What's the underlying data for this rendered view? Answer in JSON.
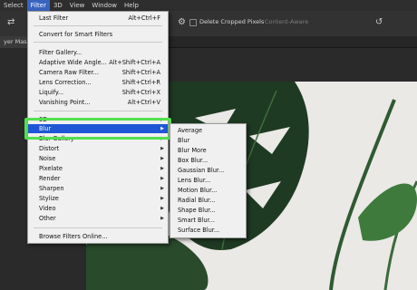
{
  "menubar": {
    "items": [
      "Select",
      "Filter",
      "3D",
      "View",
      "Window",
      "Help"
    ],
    "active_index": 1
  },
  "options_bar": {
    "delete_cropped_pixels_label": "Delete Cropped Pixels",
    "content_aware_label": "Content-Aware",
    "icons": [
      "swap-icon",
      "settings-gear-icon",
      "reset-icon"
    ]
  },
  "document_tab": {
    "label": "yer Mask"
  },
  "filter_menu": {
    "items": [
      {
        "label": "Last Filter",
        "shortcut": "Alt+Ctrl+F"
      },
      {
        "label": "Convert for Smart Filters",
        "shortcut": ""
      },
      {
        "label": "Filter Gallery...",
        "shortcut": ""
      },
      {
        "label": "Adaptive Wide Angle...",
        "shortcut": "Alt+Shift+Ctrl+A"
      },
      {
        "label": "Camera Raw Filter...",
        "shortcut": "Shift+Ctrl+A"
      },
      {
        "label": "Lens Correction...",
        "shortcut": "Shift+Ctrl+R"
      },
      {
        "label": "Liquify...",
        "shortcut": "Shift+Ctrl+X"
      },
      {
        "label": "Vanishing Point...",
        "shortcut": "Alt+Ctrl+V"
      },
      {
        "label": "3D",
        "shortcut": ""
      },
      {
        "label": "Blur",
        "shortcut": ""
      },
      {
        "label": "Blur Gallery",
        "shortcut": ""
      },
      {
        "label": "Distort",
        "shortcut": ""
      },
      {
        "label": "Noise",
        "shortcut": ""
      },
      {
        "label": "Pixelate",
        "shortcut": ""
      },
      {
        "label": "Render",
        "shortcut": ""
      },
      {
        "label": "Sharpen",
        "shortcut": ""
      },
      {
        "label": "Stylize",
        "shortcut": ""
      },
      {
        "label": "Video",
        "shortcut": ""
      },
      {
        "label": "Other",
        "shortcut": ""
      },
      {
        "label": "Browse Filters Online...",
        "shortcut": ""
      }
    ],
    "highlighted": "Blur"
  },
  "blur_submenu": {
    "items": [
      "Average",
      "Blur",
      "Blur More",
      "Box Blur...",
      "Gaussian Blur...",
      "Lens Blur...",
      "Motion Blur...",
      "Radial Blur...",
      "Shape Blur...",
      "Smart Blur...",
      "Surface Blur..."
    ]
  },
  "colors": {
    "highlight": "#1e56d6",
    "callout_outline": "#53e04f",
    "menu_bg": "#f0f0f0",
    "app_bg": "#2a2a2a"
  }
}
